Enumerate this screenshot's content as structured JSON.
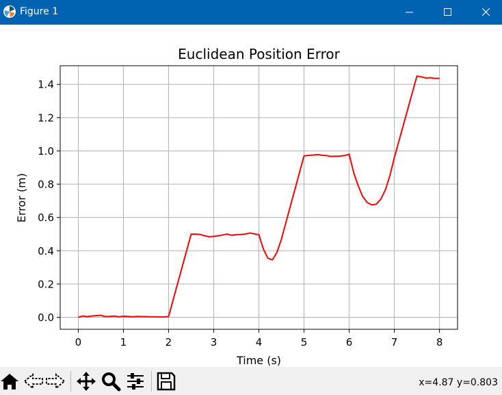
{
  "window": {
    "title": "Figure 1",
    "titlebar_color": "#0063b1",
    "controls": [
      "minimize-icon",
      "maximize-icon",
      "close-icon"
    ]
  },
  "toolbar": {
    "buttons": [
      "home-icon",
      "back-icon",
      "forward-icon",
      "pan-icon",
      "zoom-icon",
      "configure-subplots-icon",
      "save-icon"
    ],
    "coords_text": "x=4.87 y=0.803"
  },
  "chart_data": {
    "type": "line",
    "title": "Euclidean Position Error",
    "xlabel": "Time (s)",
    "ylabel": "Error (m)",
    "xlim": [
      -0.4,
      8.4
    ],
    "ylim": [
      -0.072,
      1.512
    ],
    "xticks": [
      0,
      1,
      2,
      3,
      4,
      5,
      6,
      7,
      8
    ],
    "xtick_labels": [
      "0",
      "1",
      "2",
      "3",
      "4",
      "5",
      "6",
      "7",
      "8"
    ],
    "yticks": [
      0.0,
      0.2,
      0.4,
      0.6,
      0.8,
      1.0,
      1.2,
      1.4
    ],
    "ytick_labels": [
      "0.0",
      "0.2",
      "0.4",
      "0.6",
      "0.8",
      "1.0",
      "1.2",
      "1.4"
    ],
    "grid": true,
    "series": [
      {
        "color": "#ff0000",
        "x": [
          0.0,
          0.1,
          0.2,
          0.3,
          0.4,
          0.5,
          0.6,
          0.7,
          0.8,
          0.9,
          1.0,
          1.1,
          1.2,
          1.3,
          1.4,
          1.5,
          1.6,
          1.7,
          1.8,
          1.9,
          2.0,
          2.5,
          2.6,
          2.7,
          2.8,
          2.9,
          3.0,
          3.1,
          3.2,
          3.3,
          3.4,
          3.5,
          3.6,
          3.7,
          3.8,
          3.9,
          4.0,
          4.1,
          4.2,
          4.3,
          4.4,
          4.5,
          5.0,
          5.1,
          5.2,
          5.3,
          5.4,
          5.5,
          5.6,
          5.7,
          5.8,
          5.9,
          6.0,
          6.1,
          6.2,
          6.3,
          6.4,
          6.5,
          6.6,
          6.7,
          6.8,
          6.9,
          7.0,
          7.5,
          7.6,
          7.7,
          7.8,
          7.9,
          8.0
        ],
        "y": [
          0.0,
          0.008,
          0.004,
          0.008,
          0.01,
          0.012,
          0.004,
          0.005,
          0.008,
          0.003,
          0.006,
          0.005,
          0.003,
          0.005,
          0.004,
          0.004,
          0.003,
          0.003,
          0.002,
          0.002,
          0.005,
          0.5,
          0.5,
          0.498,
          0.49,
          0.484,
          0.486,
          0.49,
          0.495,
          0.5,
          0.493,
          0.497,
          0.498,
          0.5,
          0.507,
          0.501,
          0.497,
          0.41,
          0.355,
          0.345,
          0.39,
          0.47,
          0.97,
          0.973,
          0.975,
          0.978,
          0.974,
          0.972,
          0.967,
          0.968,
          0.969,
          0.972,
          0.98,
          0.87,
          0.79,
          0.725,
          0.69,
          0.675,
          0.68,
          0.71,
          0.765,
          0.85,
          0.96,
          1.45,
          1.445,
          1.438,
          1.44,
          1.436,
          1.436
        ]
      }
    ]
  }
}
